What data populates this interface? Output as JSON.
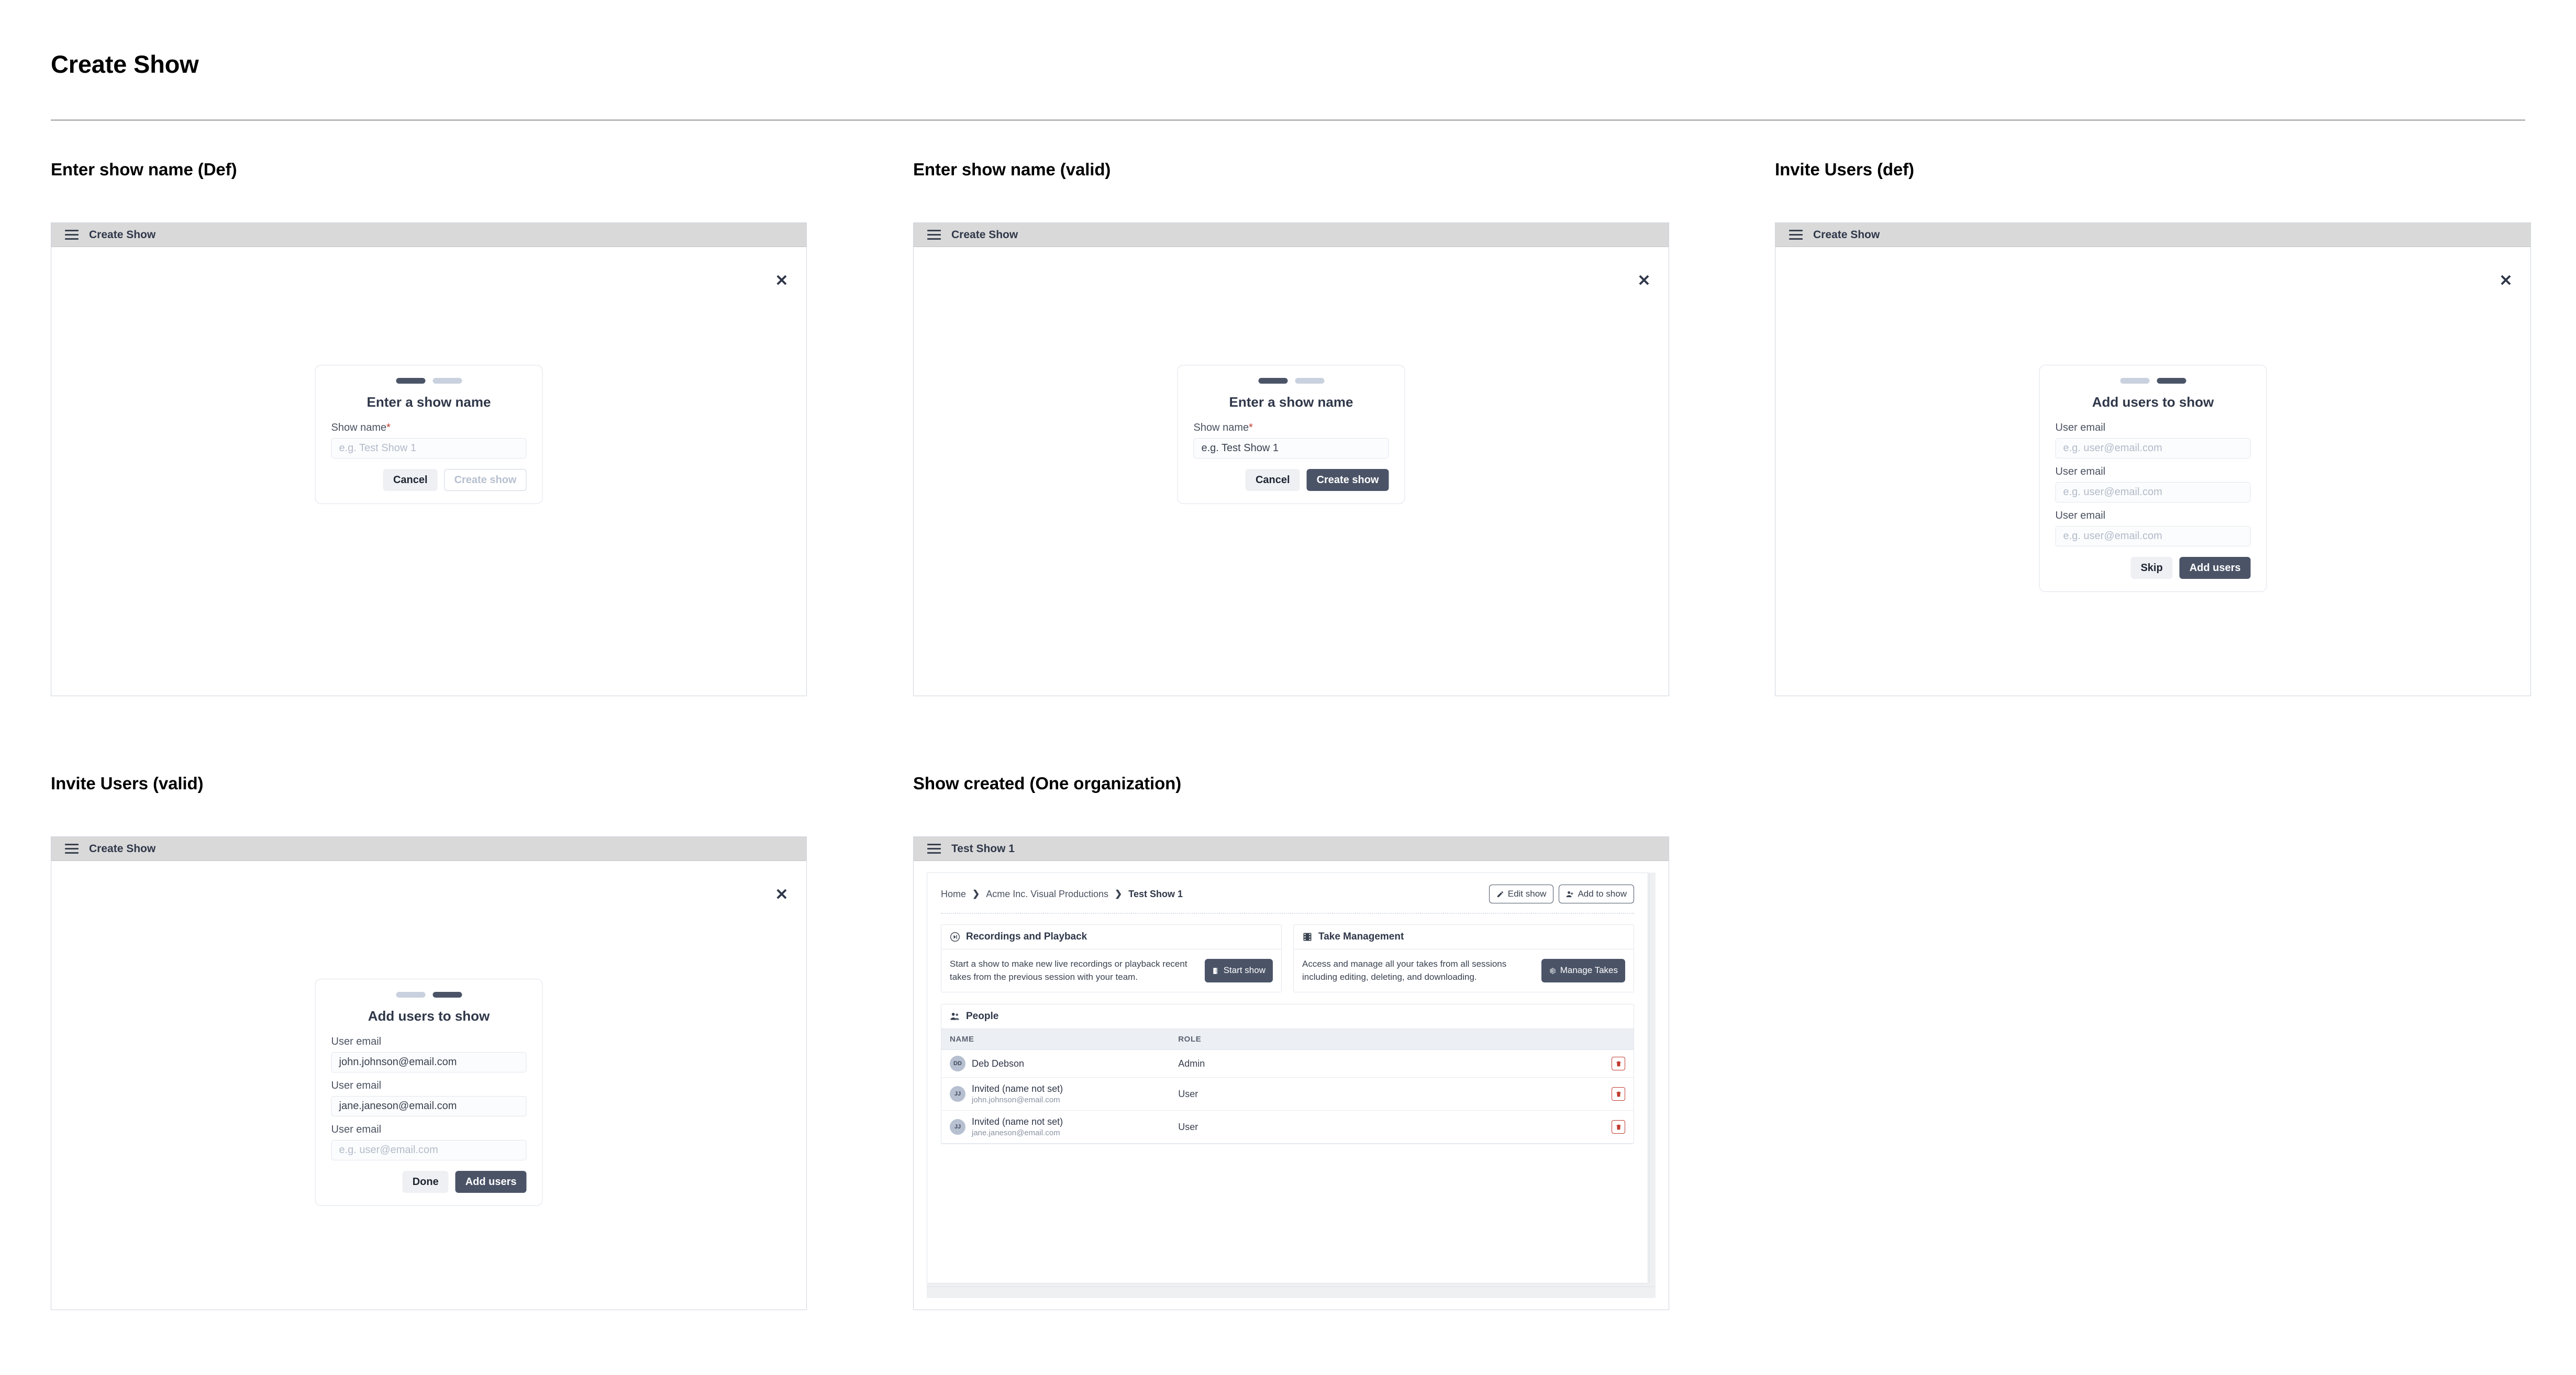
{
  "page": {
    "title": "Create Show"
  },
  "sections": [
    {
      "label": "Enter show name (Def)"
    },
    {
      "label": "Enter show name (valid)"
    },
    {
      "label": "Invite Users (def)"
    },
    {
      "label": "Invite Users (valid)"
    },
    {
      "label": "Show created (One organization)"
    }
  ],
  "window": {
    "create_show_title": "Create Show",
    "show_title": "Test Show 1",
    "close_glyph": "✕"
  },
  "name_step": {
    "modal_title": "Enter a show name",
    "field_label": "Show name",
    "required_mark": "*",
    "placeholder": "e.g. Test Show 1",
    "cancel_label": "Cancel",
    "create_label": "Create show"
  },
  "users_step": {
    "modal_title": "Add users to show",
    "field_label": "User email",
    "placeholder": "e.g. user@email.com",
    "skip_label": "Skip",
    "done_label": "Done",
    "add_label": "Add users",
    "valid_emails": [
      "john.johnson@email.com",
      "jane.janeson@email.com",
      ""
    ]
  },
  "show_page": {
    "breadcrumb": [
      "Home",
      "Acme Inc. Visual Productions",
      "Test Show 1"
    ],
    "breadcrumb_sep": "❯",
    "edit_show_label": "Edit show",
    "add_to_show_label": "Add to show",
    "cards": [
      {
        "icon": "play-circle-icon",
        "title": "Recordings and Playback",
        "body": "Start a show to make new live recordings or playback recent takes from the previous session with your team.",
        "button": "Start show",
        "button_icon": "door-icon"
      },
      {
        "icon": "film-strip-icon",
        "title": "Take Management",
        "body": "Access and manage all your takes from all sessions including editing, deleting, and downloading.",
        "button": "Manage Takes",
        "button_icon": "gear-icon"
      }
    ],
    "people": {
      "title": "People",
      "columns": [
        "NAME",
        "ROLE"
      ],
      "rows": [
        {
          "initials": "DD",
          "name": "Deb Debson",
          "email": "",
          "role": "Admin"
        },
        {
          "initials": "JJ",
          "name": "Invited (name not set)",
          "email": "john.johnson@email.com",
          "role": "User"
        },
        {
          "initials": "JJ",
          "name": "Invited (name not set)",
          "email": "jane.janeson@email.com",
          "role": "User"
        }
      ]
    }
  },
  "colors": {
    "accent": "#4b5467",
    "titlebar": "#d9d9d9",
    "danger": "#c0392b",
    "step_inactive": "#c9d1de"
  }
}
